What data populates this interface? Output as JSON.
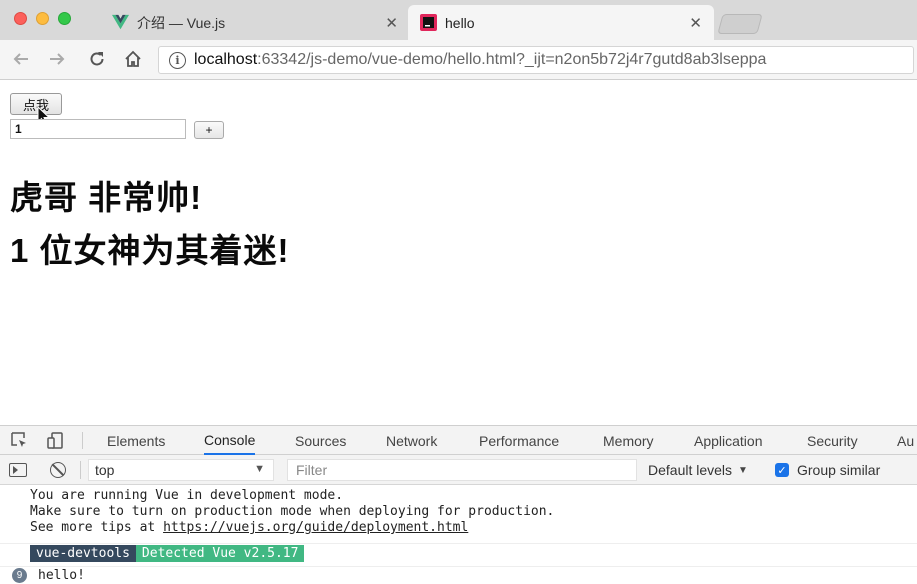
{
  "browser": {
    "tabs": [
      {
        "title": "介绍 — Vue.js",
        "favicon": "vue-logo-icon",
        "active": false
      },
      {
        "title": "hello",
        "favicon": "webstorm-icon",
        "active": true
      }
    ],
    "close_glyph": "✕",
    "address": {
      "host": "localhost",
      "rest": ":63342/js-demo/vue-demo/hello.html?_ijt=n2on5b72j4r7gutd8ab3lseppa"
    }
  },
  "page": {
    "click_button_label": "点我",
    "input_value": "1",
    "plus_button_label": "+",
    "line1": "虎哥 非常帅!",
    "line2": "1 位女神为其着迷!"
  },
  "devtools": {
    "tabs": [
      "Elements",
      "Console",
      "Sources",
      "Network",
      "Performance",
      "Memory",
      "Application",
      "Security",
      "Au"
    ],
    "active_tab": "Console",
    "console_bar": {
      "context": "top",
      "filter_placeholder": "Filter",
      "levels": "Default levels",
      "group_similar": "Group similar"
    },
    "messages": {
      "vue_line1": "You are running Vue in development mode.",
      "vue_line2": "Make sure to turn on production mode when deploying for production.",
      "vue_line3_prefix": "See more tips at ",
      "vue_line3_link": "https://vuejs.org/guide/deployment.html",
      "badge_left": "vue-devtools",
      "badge_right": "Detected Vue v2.5.17",
      "hello_count": "9",
      "hello_text": "hello!"
    }
  },
  "colors": {
    "accent": "#1a73e8",
    "vue_dark": "#35495e",
    "vue_green": "#41b883"
  }
}
